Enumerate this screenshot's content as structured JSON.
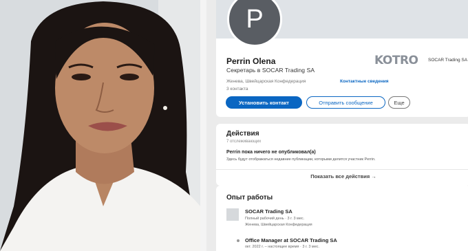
{
  "profile": {
    "avatar_letter": "P",
    "name": "Perrin Olena",
    "headline": "Секретарь в SOCAR Trading SA",
    "location": "Женева, Швейцарская Конфедерация",
    "contact_link": "Контактные сведения",
    "connections": "3 контакта",
    "company_logo_text": "KOTRO",
    "company_name": "SOCAR Trading SA"
  },
  "actions": {
    "primary": "Установить контакт",
    "secondary": "Отправить сообщение",
    "more": "Еще"
  },
  "activity": {
    "title": "Действия",
    "followers": "7 отслеживающих",
    "post_title": "Perrin пока ничего не опубликовал(а)",
    "post_text": "Здесь будут отображаться недавние публикации, которыми делится участник Perrin.",
    "show_all": "Показать все действия →"
  },
  "experience": {
    "title": "Опыт работы",
    "company": "SOCAR Trading SA",
    "employment": "Полный рабочий день · 3 г. 3 мес.",
    "location": "Женева, Швейцарская Конфедерация",
    "role": "Office Manager at SOCAR Trading SA",
    "dates": "окт. 2022 г. – настоящее время · 3 г. 3 мес."
  },
  "colors": {
    "accent": "#0a66c2",
    "avatar_bg": "#595d63"
  }
}
